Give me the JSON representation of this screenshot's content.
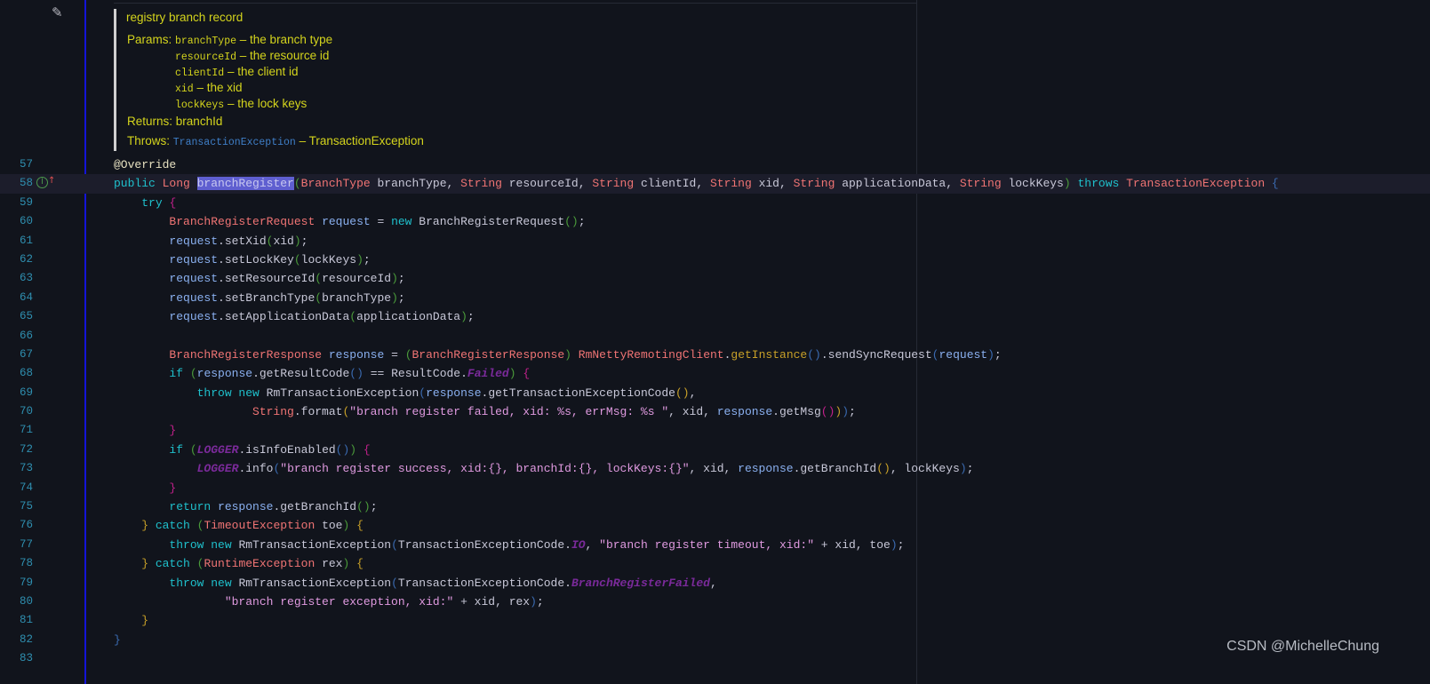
{
  "doc": {
    "summary": "registry branch record",
    "params_label": "Params:",
    "params": [
      {
        "name": "branchType",
        "desc": "– the branch type"
      },
      {
        "name": "resourceId",
        "desc": "– the resource id"
      },
      {
        "name": "clientId",
        "desc": "– the client id"
      },
      {
        "name": "xid",
        "desc": "– the xid"
      },
      {
        "name": "lockKeys",
        "desc": "– the lock keys"
      }
    ],
    "returns_label": "Returns:",
    "returns": "branchId",
    "throws_label": "Throws:",
    "throws_type": "TransactionException",
    "throws_desc": "– TransactionException"
  },
  "gutter": {
    "edit_icon": "pencil-icon",
    "implements_icon": "implements-method-icon",
    "current_line": 58
  },
  "colors": {
    "background": "#11141c",
    "keyword": "#1fc0cc",
    "type": "#f07474",
    "variable": "#8ab0f0",
    "string": "#e09ae0",
    "constant": "#7a2a9a",
    "selection": "#5f5fd0"
  },
  "lines": [
    {
      "n": "57",
      "tokens": [
        [
          "a",
          "@Override"
        ]
      ]
    },
    {
      "n": "58",
      "tokens": [
        [
          "k",
          "public "
        ],
        [
          "t",
          "Long "
        ],
        [
          "sel",
          "branchRegister"
        ],
        [
          "b1",
          "("
        ],
        [
          "t",
          "BranchType "
        ],
        [
          "p",
          "branchType, "
        ],
        [
          "t",
          "String "
        ],
        [
          "p",
          "resourceId, "
        ],
        [
          "t",
          "String "
        ],
        [
          "p",
          "clientId, "
        ],
        [
          "t",
          "String "
        ],
        [
          "p",
          "xid, "
        ],
        [
          "t",
          "String "
        ],
        [
          "p",
          "applicationData, "
        ],
        [
          "t",
          "String "
        ],
        [
          "p",
          "lockKeys"
        ],
        [
          "b1",
          ")"
        ],
        [
          "p",
          " "
        ],
        [
          "k",
          "throws "
        ],
        [
          "t",
          "TransactionException "
        ],
        [
          "b2",
          "{"
        ]
      ]
    },
    {
      "n": "59",
      "tokens": [
        [
          "p",
          "    "
        ],
        [
          "k",
          "try "
        ],
        [
          "b3",
          "{"
        ]
      ]
    },
    {
      "n": "60",
      "tokens": [
        [
          "p",
          "        "
        ],
        [
          "t",
          "BranchRegisterRequest "
        ],
        [
          "v",
          "request"
        ],
        [
          "p",
          " = "
        ],
        [
          "k",
          "new "
        ],
        [
          "p",
          "BranchRegisterRequest"
        ],
        [
          "b1",
          "()"
        ],
        [
          "p",
          ";"
        ]
      ]
    },
    {
      "n": "61",
      "tokens": [
        [
          "p",
          "        "
        ],
        [
          "v",
          "request"
        ],
        [
          "p",
          ".setXid"
        ],
        [
          "b1",
          "("
        ],
        [
          "p",
          "xid"
        ],
        [
          "b1",
          ")"
        ],
        [
          "p",
          ";"
        ]
      ]
    },
    {
      "n": "62",
      "tokens": [
        [
          "p",
          "        "
        ],
        [
          "v",
          "request"
        ],
        [
          "p",
          ".setLockKey"
        ],
        [
          "b1",
          "("
        ],
        [
          "p",
          "lockKeys"
        ],
        [
          "b1",
          ")"
        ],
        [
          "p",
          ";"
        ]
      ]
    },
    {
      "n": "63",
      "tokens": [
        [
          "p",
          "        "
        ],
        [
          "v",
          "request"
        ],
        [
          "p",
          ".setResourceId"
        ],
        [
          "b1",
          "("
        ],
        [
          "p",
          "resourceId"
        ],
        [
          "b1",
          ")"
        ],
        [
          "p",
          ";"
        ]
      ]
    },
    {
      "n": "64",
      "tokens": [
        [
          "p",
          "        "
        ],
        [
          "v",
          "request"
        ],
        [
          "p",
          ".setBranchType"
        ],
        [
          "b1",
          "("
        ],
        [
          "p",
          "branchType"
        ],
        [
          "b1",
          ")"
        ],
        [
          "p",
          ";"
        ]
      ]
    },
    {
      "n": "65",
      "tokens": [
        [
          "p",
          "        "
        ],
        [
          "v",
          "request"
        ],
        [
          "p",
          ".setApplicationData"
        ],
        [
          "b1",
          "("
        ],
        [
          "p",
          "applicationData"
        ],
        [
          "b1",
          ")"
        ],
        [
          "p",
          ";"
        ]
      ]
    },
    {
      "n": "66",
      "tokens": []
    },
    {
      "n": "67",
      "tokens": [
        [
          "p",
          "        "
        ],
        [
          "t",
          "BranchRegisterResponse "
        ],
        [
          "v",
          "response"
        ],
        [
          "p",
          " = "
        ],
        [
          "b1",
          "("
        ],
        [
          "t",
          "BranchRegisterResponse"
        ],
        [
          "b1",
          ")"
        ],
        [
          "p",
          " "
        ],
        [
          "t",
          "RmNettyRemotingClient"
        ],
        [
          "p",
          "."
        ],
        [
          "b4",
          "getInstance"
        ],
        [
          "b2",
          "()"
        ],
        [
          "p",
          ".sendSyncRequest"
        ],
        [
          "b2",
          "("
        ],
        [
          "v",
          "request"
        ],
        [
          "b2",
          ")"
        ],
        [
          "p",
          ";"
        ]
      ]
    },
    {
      "n": "68",
      "tokens": [
        [
          "p",
          "        "
        ],
        [
          "k",
          "if "
        ],
        [
          "b1",
          "("
        ],
        [
          "v",
          "response"
        ],
        [
          "p",
          ".getResultCode"
        ],
        [
          "b2",
          "()"
        ],
        [
          "p",
          " == ResultCode."
        ],
        [
          "c",
          "Failed"
        ],
        [
          "b1",
          ")"
        ],
        [
          "p",
          " "
        ],
        [
          "b3",
          "{"
        ]
      ]
    },
    {
      "n": "69",
      "tokens": [
        [
          "p",
          "            "
        ],
        [
          "k",
          "throw new "
        ],
        [
          "p",
          "RmTransactionException"
        ],
        [
          "b2",
          "("
        ],
        [
          "v",
          "response"
        ],
        [
          "p",
          ".getTransactionExceptionCode"
        ],
        [
          "b4",
          "()"
        ],
        [
          "p",
          ","
        ]
      ]
    },
    {
      "n": "70",
      "tokens": [
        [
          "p",
          "                    "
        ],
        [
          "t",
          "String"
        ],
        [
          "p",
          ".format"
        ],
        [
          "b4",
          "("
        ],
        [
          "s",
          "\"branch register failed, xid: %s, errMsg: %s \""
        ],
        [
          "p",
          ", xid, "
        ],
        [
          "v",
          "response"
        ],
        [
          "p",
          ".getMsg"
        ],
        [
          "b3",
          "()"
        ],
        [
          "b4",
          ")"
        ],
        [
          "b2",
          ")"
        ],
        [
          "p",
          ";"
        ]
      ]
    },
    {
      "n": "71",
      "tokens": [
        [
          "p",
          "        "
        ],
        [
          "b3",
          "}"
        ]
      ]
    },
    {
      "n": "72",
      "tokens": [
        [
          "p",
          "        "
        ],
        [
          "k",
          "if "
        ],
        [
          "b1",
          "("
        ],
        [
          "c",
          "LOGGER"
        ],
        [
          "p",
          ".isInfoEnabled"
        ],
        [
          "b2",
          "()"
        ],
        [
          "b1",
          ")"
        ],
        [
          "p",
          " "
        ],
        [
          "b3",
          "{"
        ]
      ]
    },
    {
      "n": "73",
      "tokens": [
        [
          "p",
          "            "
        ],
        [
          "c",
          "LOGGER"
        ],
        [
          "p",
          ".info"
        ],
        [
          "b2",
          "("
        ],
        [
          "s",
          "\"branch register success, xid:{}, branchId:{}, lockKeys:{}\""
        ],
        [
          "p",
          ", xid, "
        ],
        [
          "v",
          "response"
        ],
        [
          "p",
          ".getBranchId"
        ],
        [
          "b4",
          "()"
        ],
        [
          "p",
          ", lockKeys"
        ],
        [
          "b2",
          ")"
        ],
        [
          "p",
          ";"
        ]
      ]
    },
    {
      "n": "74",
      "tokens": [
        [
          "p",
          "        "
        ],
        [
          "b3",
          "}"
        ]
      ]
    },
    {
      "n": "75",
      "tokens": [
        [
          "p",
          "        "
        ],
        [
          "k",
          "return "
        ],
        [
          "v",
          "response"
        ],
        [
          "p",
          ".getBranchId"
        ],
        [
          "b1",
          "()"
        ],
        [
          "p",
          ";"
        ]
      ]
    },
    {
      "n": "76",
      "tokens": [
        [
          "p",
          "    "
        ],
        [
          "b4",
          "} "
        ],
        [
          "k",
          "catch "
        ],
        [
          "b1",
          "("
        ],
        [
          "t",
          "TimeoutException "
        ],
        [
          "p",
          "toe"
        ],
        [
          "b1",
          ")"
        ],
        [
          "p",
          " "
        ],
        [
          "b4",
          "{"
        ]
      ]
    },
    {
      "n": "77",
      "tokens": [
        [
          "p",
          "        "
        ],
        [
          "k",
          "throw new "
        ],
        [
          "p",
          "RmTransactionException"
        ],
        [
          "b2",
          "("
        ],
        [
          "p",
          "TransactionExceptionCode."
        ],
        [
          "c",
          "IO"
        ],
        [
          "p",
          ", "
        ],
        [
          "s",
          "\"branch register timeout, xid:\""
        ],
        [
          "p",
          " + xid, toe"
        ],
        [
          "b2",
          ")"
        ],
        [
          "p",
          ";"
        ]
      ]
    },
    {
      "n": "78",
      "tokens": [
        [
          "p",
          "    "
        ],
        [
          "b4",
          "} "
        ],
        [
          "k",
          "catch "
        ],
        [
          "b1",
          "("
        ],
        [
          "t",
          "RuntimeException "
        ],
        [
          "p",
          "rex"
        ],
        [
          "b1",
          ")"
        ],
        [
          "p",
          " "
        ],
        [
          "b4",
          "{"
        ]
      ]
    },
    {
      "n": "79",
      "tokens": [
        [
          "p",
          "        "
        ],
        [
          "k",
          "throw new "
        ],
        [
          "p",
          "RmTransactionException"
        ],
        [
          "b2",
          "("
        ],
        [
          "p",
          "TransactionExceptionCode."
        ],
        [
          "c",
          "BranchRegisterFailed"
        ],
        [
          "p",
          ","
        ]
      ]
    },
    {
      "n": "80",
      "tokens": [
        [
          "p",
          "                "
        ],
        [
          "s",
          "\"branch register exception, xid:\""
        ],
        [
          "p",
          " + xid, rex"
        ],
        [
          "b2",
          ")"
        ],
        [
          "p",
          ";"
        ]
      ]
    },
    {
      "n": "81",
      "tokens": [
        [
          "p",
          "    "
        ],
        [
          "b4",
          "}"
        ]
      ]
    },
    {
      "n": "82",
      "tokens": [
        [
          "b2",
          "}"
        ]
      ]
    },
    {
      "n": "83",
      "tokens": []
    }
  ],
  "watermark": "CSDN @MichelleChung"
}
